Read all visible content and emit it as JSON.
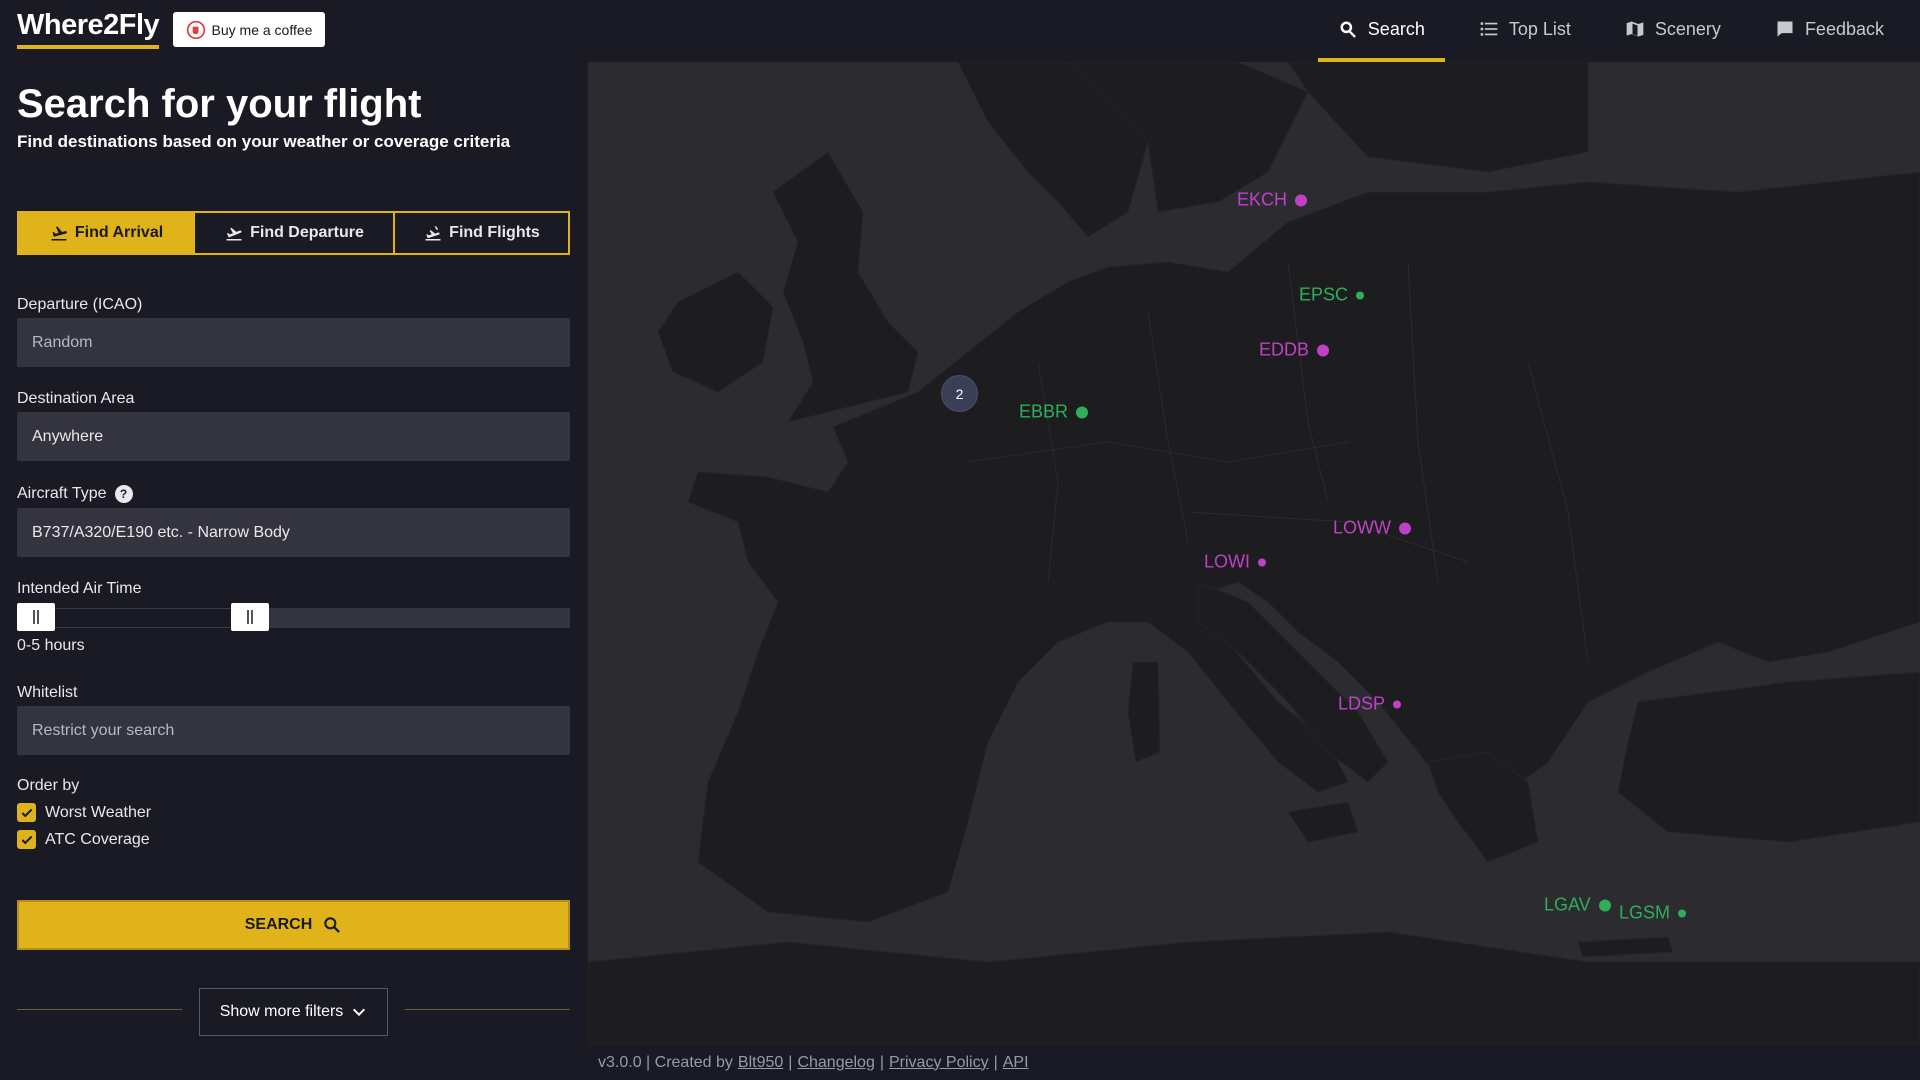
{
  "header": {
    "logo": "Where2Fly",
    "coffee_label": "Buy me a coffee",
    "nav": [
      {
        "label": "Search",
        "icon": "search-icon",
        "active": true
      },
      {
        "label": "Top List",
        "icon": "list-icon",
        "active": false
      },
      {
        "label": "Scenery",
        "icon": "map-icon",
        "active": false
      },
      {
        "label": "Feedback",
        "icon": "chat-icon",
        "active": false
      }
    ]
  },
  "panel": {
    "title": "Search for your flight",
    "subtitle": "Find destinations based on your weather or coverage criteria",
    "tabs": [
      {
        "label": "Find Arrival",
        "active": true
      },
      {
        "label": "Find Departure",
        "active": false
      },
      {
        "label": "Find Flights",
        "active": false
      }
    ],
    "departure": {
      "label": "Departure (ICAO)",
      "placeholder": "Random"
    },
    "destination": {
      "label": "Destination Area",
      "value": "Anywhere"
    },
    "aircraft": {
      "label": "Aircraft Type",
      "value": "B737/A320/E190 etc. - Narrow Body"
    },
    "airtime": {
      "label": "Intended Air Time",
      "value": "0-5 hours",
      "min_hours": 0,
      "max_hours": 5
    },
    "whitelist": {
      "label": "Whitelist",
      "placeholder": "Restrict your search"
    },
    "order": {
      "label": "Order by",
      "options": [
        {
          "label": "Worst Weather",
          "checked": true
        },
        {
          "label": "ATC Coverage",
          "checked": true
        }
      ]
    },
    "search_label": "SEARCH",
    "more_filters_label": "Show more filters"
  },
  "map": {
    "cluster_count": "2",
    "markers": [
      {
        "code": "EKCH",
        "color": "#c040c8"
      },
      {
        "code": "EPSC",
        "color": "#2fae5a"
      },
      {
        "code": "EDDB",
        "color": "#c040c8"
      },
      {
        "code": "EBBR",
        "color": "#2fae5a"
      },
      {
        "code": "LOWW",
        "color": "#c040c8"
      },
      {
        "code": "LOWI",
        "color": "#c040c8"
      },
      {
        "code": "LDSP",
        "color": "#c040c8"
      },
      {
        "code": "LGAV",
        "color": "#2fae5a"
      },
      {
        "code": "LGSM",
        "color": "#2fae5a"
      }
    ]
  },
  "footer": {
    "version": "v3.0.0 | Created by",
    "author": "Blt950",
    "links": [
      "Changelog",
      "Privacy Policy",
      "API"
    ],
    "sep": "|"
  },
  "colors": {
    "accent": "#e0b31a",
    "background": "#1a1a25",
    "input": "#343440",
    "weather_marker": "#c040c8",
    "atc_marker": "#2fae5a"
  }
}
